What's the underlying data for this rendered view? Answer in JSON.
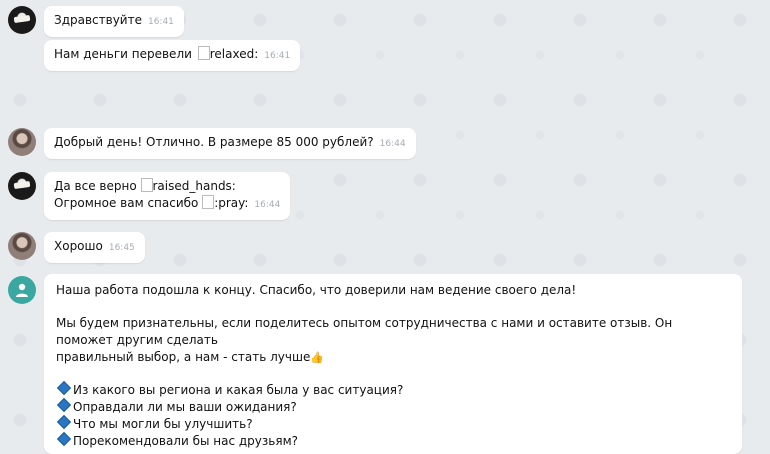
{
  "chat": {
    "messages": [
      {
        "text": "Здравствуйте",
        "time": "16:41"
      },
      {
        "text": "Нам деньги перевели",
        "emoji": "relaxed:",
        "time": "16:41"
      },
      {
        "text": "Добрый день! Отлично. В размере 85 000 рублей?",
        "time": "16:44"
      },
      {
        "line1_text": "Да все верно",
        "line1_emoji": "raised_hands:",
        "line2_text": "Огромное вам спасибо",
        "line2_emoji": ":pray:",
        "time": "16:44"
      },
      {
        "text": "Хорошо",
        "time": "16:45"
      }
    ],
    "final": {
      "para1": "Наша работа подошла к концу. Спасибо, что доверили нам ведение своего дела!",
      "para2_line1": "Мы будем признательны, если поделитесь опытом сотрудничества с нами и оставите отзыв. Он поможет другим сделать",
      "para2_line2": "правильный выбор, а нам - стать лучше",
      "questions": [
        "Из какого вы региона и какая была у вас ситуация?",
        "Оправдали ли мы ваши ожидания?",
        "Что мы могли бы улучшить?",
        "Порекомендовали бы нас друзьям?"
      ]
    }
  },
  "icons": {
    "broken_image": "broken-image-icon",
    "thumbs_up": "thumbs-up-icon",
    "bullet": "blue-diamond-icon"
  },
  "colors": {
    "background": "#e7ebee",
    "bubble": "#ffffff",
    "time": "#a7adb3",
    "system_avatar": "#3aa8a0"
  }
}
